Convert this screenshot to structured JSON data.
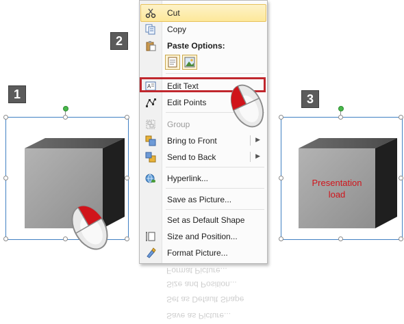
{
  "steps": [
    "1",
    "2",
    "3"
  ],
  "menu": {
    "cut": "Cut",
    "copy": "Copy",
    "paste_options": "Paste Options:",
    "edit_text": "Edit Text",
    "edit_points": "Edit Points",
    "group": "Group",
    "bring_to_front": "Bring to Front",
    "send_to_back": "Send to Back",
    "hyperlink": "Hyperlink...",
    "save_as_picture": "Save as Picture...",
    "set_default_shape": "Set as Default Shape",
    "size_position": "Size and Position...",
    "format_picture": "Format Picture..."
  },
  "cube_text": "Presentation\nload",
  "colors": {
    "accent_red": "#c0272d",
    "selection_blue": "#3f7fc2",
    "step_badge": "#5b5b5b"
  },
  "icons": [
    "scissors-icon",
    "copy-icon",
    "paste-icon",
    "paste-keep-icon",
    "paste-picture-icon",
    "edit-text-icon",
    "edit-points-icon",
    "group-icon",
    "bring-front-icon",
    "send-back-icon",
    "hyperlink-icon",
    "size-position-icon",
    "format-picture-icon",
    "mouse-icon"
  ]
}
